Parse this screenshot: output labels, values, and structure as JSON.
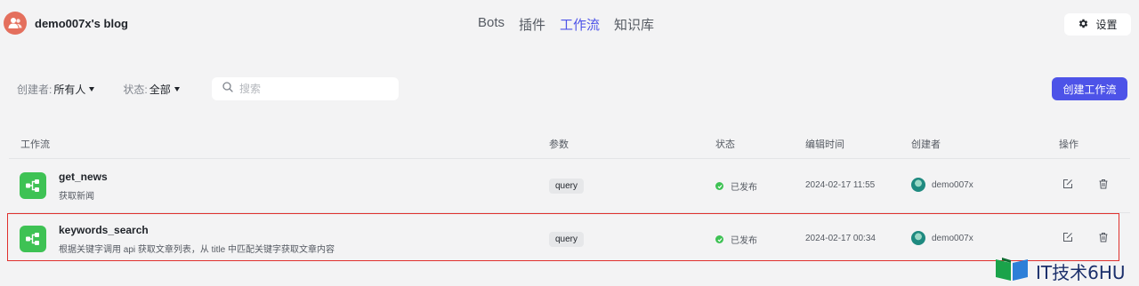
{
  "header": {
    "brand_name": "demo007x's blog",
    "nav_tabs": [
      {
        "label": "Bots",
        "active": false
      },
      {
        "label": "插件",
        "active": false
      },
      {
        "label": "工作流",
        "active": true
      },
      {
        "label": "知识库",
        "active": false
      }
    ],
    "settings_label": "设置"
  },
  "filters": {
    "creator_label": "创建者:",
    "creator_value": "所有人",
    "status_label": "状态:",
    "status_value": "全部",
    "search_placeholder": "搜索"
  },
  "create_button_label": "创建工作流",
  "table": {
    "columns": [
      "工作流",
      "参数",
      "状态",
      "编辑时间",
      "创建者",
      "操作"
    ],
    "rows": [
      {
        "name": "get_news",
        "description": "获取新闻",
        "param": "query",
        "status": "已发布",
        "edited_time": "2024-02-17 11:55",
        "creator": "demo007x"
      },
      {
        "name": "keywords_search",
        "description": "根据关键字调用 api 获取文章列表，从 title 中匹配关键字获取文章内容",
        "param": "query",
        "status": "已发布",
        "edited_time": "2024-02-17 00:34",
        "creator": "demo007x"
      }
    ]
  },
  "watermark": "IT技术6HU",
  "colors": {
    "accent": "#4d53e8",
    "status_green": "#3ec254",
    "highlight_red": "#e0302d",
    "avatar": "#e46f5d"
  }
}
